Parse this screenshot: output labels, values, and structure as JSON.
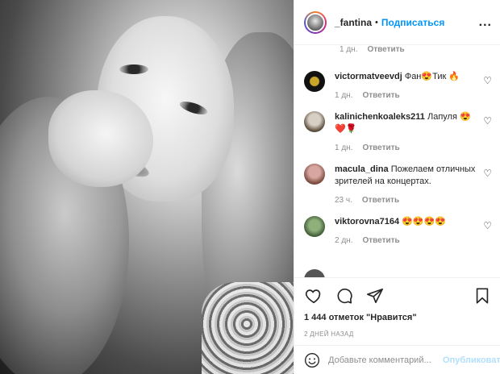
{
  "header": {
    "username": "_fantina",
    "separator": "•",
    "follow_label": "Подписаться",
    "more_label": "..."
  },
  "top_meta": {
    "time": "1 дн.",
    "reply_label": "Ответить"
  },
  "comments": [
    {
      "username": "victormatveevdj",
      "text": "Фан😍Тик 🔥",
      "time": "1 дн.",
      "reply_label": "Ответить"
    },
    {
      "username": "kalinichenkoaleks211",
      "text": "Лапуля 😍 ❤️🌹",
      "time": "1 дн.",
      "reply_label": "Ответить"
    },
    {
      "username": "macula_dina",
      "text": "Пожелаем отличных зрителей на концертах.",
      "time": "23 ч.",
      "reply_label": "Ответить"
    },
    {
      "username": "viktorovna7164",
      "text": "😍😍😍😍",
      "time": "2 дн.",
      "reply_label": "Ответить"
    }
  ],
  "likes_text": "1 444 отметок \"Нравится\"",
  "date_text": "2 ДНЕЙ НАЗАД",
  "add_comment": {
    "placeholder": "Добавьте комментарий...",
    "publish_label": "Опубликовать"
  },
  "colors": {
    "link": "#0095f6",
    "publish_disabled": "#b2dffc",
    "meta": "#8e8e8e",
    "text": "#262626"
  },
  "icons": [
    "heart-icon",
    "comment-icon",
    "share-icon",
    "bookmark-icon",
    "emoji-icon",
    "more-icon"
  ]
}
